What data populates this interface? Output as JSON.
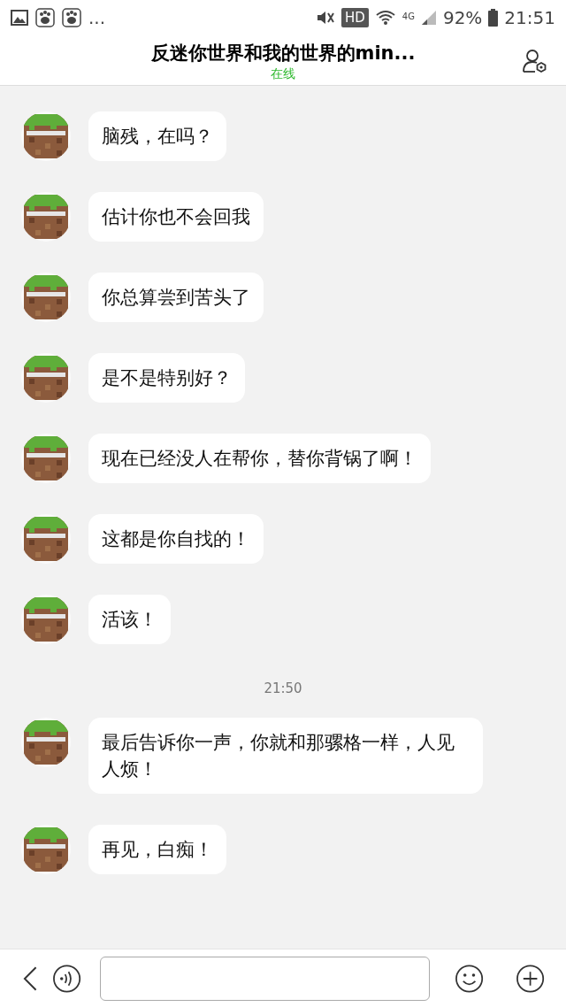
{
  "status_bar": {
    "notifications": "...",
    "battery": "92%",
    "time": "21:51",
    "network": "4G",
    "hd": "HD"
  },
  "header": {
    "title": "反迷你世界和我的世界的min...",
    "status": "在线"
  },
  "messages": [
    {
      "kind": "message",
      "text": "脑残，在吗？"
    },
    {
      "kind": "message",
      "text": "估计你也不会回我"
    },
    {
      "kind": "message",
      "text": "你总算尝到苦头了"
    },
    {
      "kind": "message",
      "text": "是不是特别好？"
    },
    {
      "kind": "message",
      "text": "现在已经没人在帮你，替你背锅了啊！"
    },
    {
      "kind": "message",
      "text": "这都是你自找的！"
    },
    {
      "kind": "message",
      "text": "活该！"
    },
    {
      "kind": "time",
      "text": "21:50"
    },
    {
      "kind": "message",
      "text": "最后告诉你一声，你就和那骡格一样，人见人烦！"
    },
    {
      "kind": "message",
      "text": "再见，白痴！"
    }
  ]
}
